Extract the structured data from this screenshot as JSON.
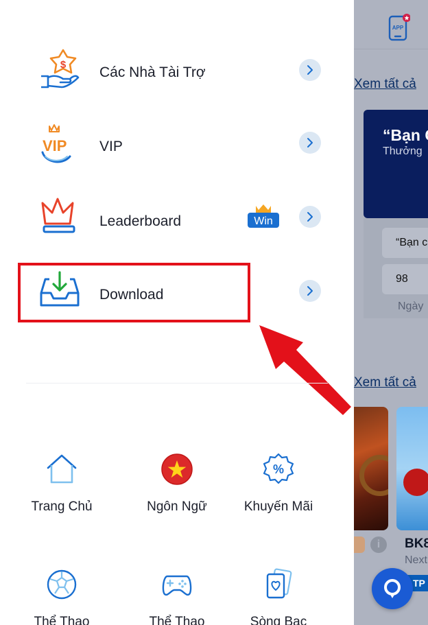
{
  "header": {
    "app_icon_label": "APP"
  },
  "background": {
    "see_all_1": "Xem tất cả",
    "see_all_2": "Xem tất cả",
    "banner_quote": "“Bạn C",
    "banner_sub": "Thưởng",
    "card_text": "“Bạn c",
    "card_value": "98",
    "card_day": "Ngày",
    "game_name": "BK8",
    "game_sub": "Next",
    "game_tag": "TP"
  },
  "menu": {
    "items": [
      {
        "label": "Các Nhà Tài Trợ",
        "icon": "sponsor-hand-coin-icon"
      },
      {
        "label": "VIP",
        "icon": "vip-crown-icon"
      },
      {
        "label": "Leaderboard",
        "icon": "leaderboard-crown-icon",
        "badge": "Win"
      },
      {
        "label": "Download",
        "icon": "download-tray-icon"
      }
    ]
  },
  "grid": {
    "items": [
      {
        "label": "Trang Chủ",
        "icon": "home-icon"
      },
      {
        "label": "Ngôn Ngữ",
        "icon": "vietnam-flag-icon"
      },
      {
        "label": "Khuyến Mãi",
        "icon": "promotion-percent-icon"
      },
      {
        "label": "Thể Thao",
        "icon": "soccer-ball-icon"
      },
      {
        "label": "Thể Thao",
        "icon": "gamepad-icon"
      },
      {
        "label": "Sòng Bạc",
        "icon": "playing-cards-icon"
      }
    ]
  },
  "colors": {
    "accent_blue": "#1a6fd0",
    "highlight_red": "#e3111a",
    "icon_orange": "#f08a24",
    "overlay_gray": "#aeb3c0"
  }
}
